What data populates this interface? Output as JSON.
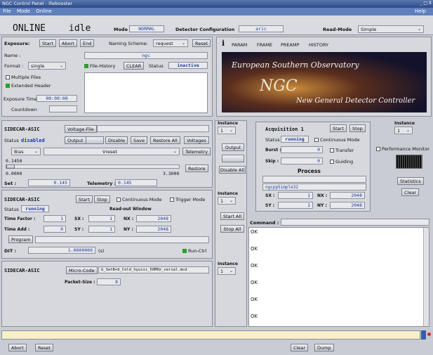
{
  "window": {
    "title": "NGC Control Panel - ifwbooster",
    "controls": "_ □ X"
  },
  "menu": {
    "file": "File",
    "mode": "Mode",
    "online": "Online",
    "help": "Help"
  },
  "top": {
    "state": "ONLINE",
    "activity": "idle",
    "mode_label": "Mode",
    "mode_value": "NORMAL",
    "detcfg_label": "Detector Configuration",
    "detcfg_value": "aric",
    "readmode_label": "Read-Mode",
    "readmode_value": "Simple"
  },
  "exposure": {
    "label": "Exposure:",
    "start": "Start",
    "abort": "Abort",
    "end": "End",
    "naming_label": "Naming Scheme:",
    "naming_value": "request",
    "reset": "Reset",
    "name_label": "Name :",
    "name_value": "ngc",
    "format_label": "Format :",
    "format_value": "single",
    "filehistory_label": "File-History",
    "clear": "CLEAR",
    "status_label": "Status",
    "status_value": "inactive",
    "multiple_files": "Multiple Files",
    "extended_header": "Extended Header",
    "exptime_label": "Exposure Time",
    "exptime_value": "00:00:00",
    "countdown_label": "Countdown"
  },
  "tabs": {
    "info": "i",
    "param": "PARAM",
    "frame": "FRAME",
    "preamp": "PREAMP",
    "history": "HISTORY"
  },
  "banner": {
    "eso": "European Southern Observatory",
    "ngc": "NGC",
    "subtitle": "New General Detector Controller"
  },
  "sidecar1": {
    "title": "SIDECAR-ASIC",
    "voltagefile": "Voltage-File",
    "status_label": "Status",
    "status_value": "disabled",
    "output": "Output",
    "disable": "Disable",
    "save": "Save",
    "restore_all": "Restore All",
    "voltages": "Voltages",
    "bias": "Bias",
    "vreset": "Vreset",
    "telemetry": "Telemetry",
    "value": "0.1450",
    "min": "0.0000",
    "max": "3.3000",
    "restore": "Restore",
    "set_label": "Set :",
    "set_value": "0.145",
    "tele_label": "Telemetry :",
    "tele_value": "0.145"
  },
  "sidecar2": {
    "title": "SIDECAR-ASIC",
    "start": "Start",
    "stop": "Stop",
    "continuous": "Continuous Mode",
    "trigger": "Trigger Mode",
    "status_label": "Status",
    "status_value": "running",
    "readout_window": "Read-out Window",
    "timefactor_label": "Time Factor :",
    "timefactor_value": "1",
    "timeadd_label": "Time Add :",
    "timeadd_value": "0",
    "sx_label": "SX :",
    "sx_value": "1",
    "nx_label": "NX :",
    "nx_value": "2048",
    "sy_label": "SY :",
    "sy_value": "1",
    "ny_label": "NY :",
    "ny_value": "2048",
    "program": "Program",
    "dit_label": "DIT :",
    "dit_value": "1.0000000",
    "dit_unit": "(s)",
    "runctrl": "Run-Ctrl"
  },
  "sidecar3": {
    "title": "SIDECAR-ASIC",
    "microcode": "Micro-Code",
    "microcode_value": "G_SetB+d_Cold_hyuisi_50MHz_serial.mcd",
    "packet_label": "Packet-Size :",
    "packet_value": "8"
  },
  "middle": {
    "instance_label": "Instance",
    "instance_value": "1",
    "output": "Output",
    "disable_all": "Disable All",
    "start_all": "Start All",
    "stop_all": "Stop All"
  },
  "acq": {
    "title": "Acquisition 1",
    "start": "Start",
    "stop": "Stop",
    "status_label": "Status",
    "status_value": "running",
    "continuous": "Continuous Mode",
    "burst_label": "Burst :",
    "burst_value": "0",
    "transfer": "Transfer",
    "skip_label": "Skip :",
    "skip_value": "0",
    "guiding": "Guiding",
    "process_label": "Process",
    "process_value": "ngcppSimple32",
    "sx_label": "SX :",
    "sx_value": "1",
    "nx_label": "NX :",
    "nx_value": "2048",
    "sy_label": "SY :",
    "sy_value": "1",
    "ny_label": "NY :",
    "ny_value": "2048"
  },
  "right": {
    "instance_label": "Instance",
    "instance_value": "1",
    "perfmon": "Performance Monitor",
    "statistics": "Statistics",
    "clear": "Clear"
  },
  "command": {
    "label": "Command :",
    "lines": [
      "OK",
      "OK",
      "OK",
      "OK",
      "OK",
      "OK"
    ]
  },
  "bottom": {
    "abort": "Abort",
    "reset": "Reset",
    "clear": "Clear",
    "dump": "Dump"
  }
}
